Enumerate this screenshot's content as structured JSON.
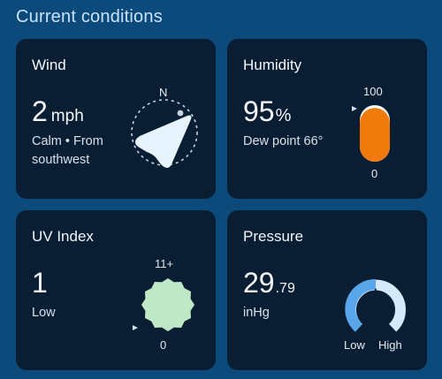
{
  "section_title": "Current conditions",
  "colors": {
    "page_bg": "#0b4a7a",
    "card_bg": "#0a1e33",
    "humidity_fill": "#f07a0c",
    "uv_fill": "#bfe9c6",
    "pressure_arc": "#8fc3f5"
  },
  "wind": {
    "title": "Wind",
    "value": "2",
    "unit": "mph",
    "description_line1": "Calm • From",
    "description_line2": "southwest",
    "compass_label": "N",
    "icon": "wind-direction-arrow-icon"
  },
  "humidity": {
    "title": "Humidity",
    "value": "95",
    "unit": "%",
    "dew_point": "Dew point 66°",
    "scale_max": "100",
    "scale_min": "0",
    "level_percent": 95
  },
  "uv": {
    "title": "UV Index",
    "value": "1",
    "description": "Low",
    "scale_max": "11+",
    "scale_min": "0"
  },
  "pressure": {
    "title": "Pressure",
    "value_whole": "29",
    "value_fraction": ".79",
    "unit": "inHg",
    "scale_low": "Low",
    "scale_high": "High"
  }
}
